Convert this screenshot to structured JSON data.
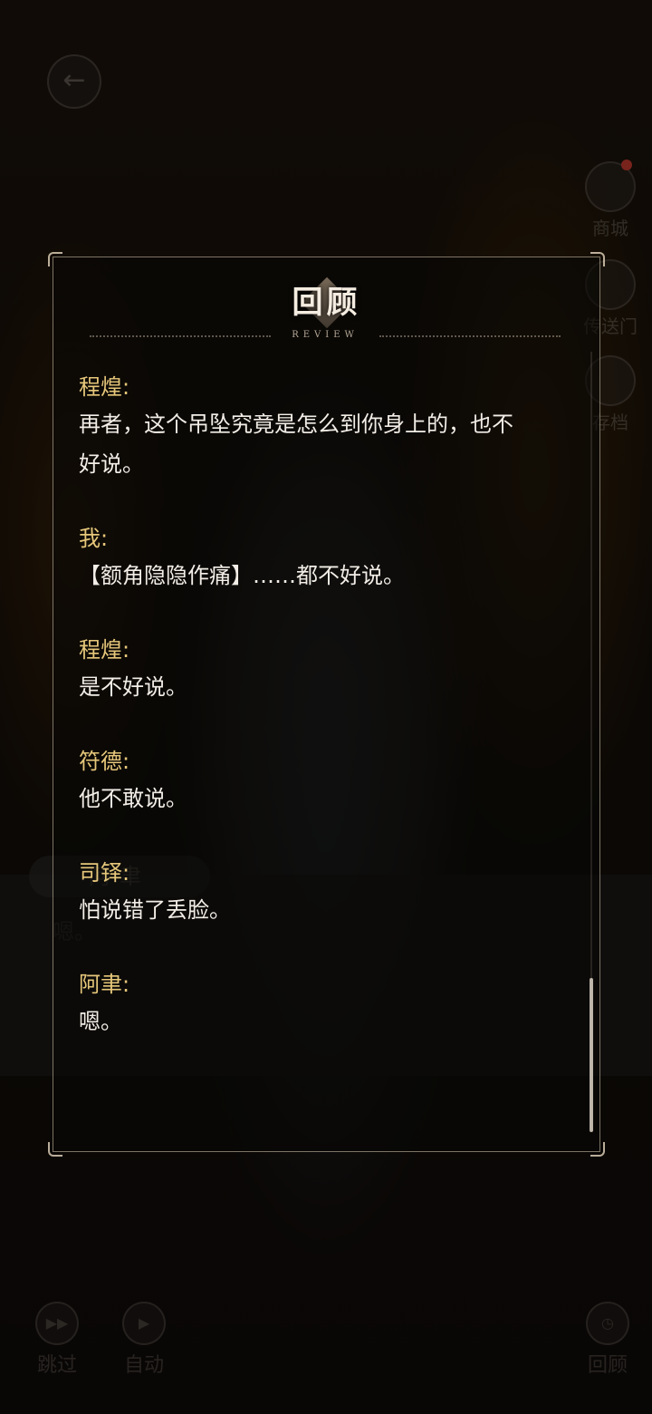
{
  "hud": {
    "back_icon": "←",
    "side": [
      {
        "label": "商城",
        "icon": "shop-icon"
      },
      {
        "label": "传送门",
        "icon": "portal-icon"
      },
      {
        "label": "存档",
        "icon": "save-icon"
      }
    ],
    "bottom": [
      {
        "label": "跳过",
        "icon": "skip-icon"
      },
      {
        "label": "自动",
        "icon": "auto-play-icon"
      },
      {
        "label": "回顾",
        "icon": "review-icon"
      }
    ],
    "speaker_tag": "阿聿",
    "current_line": "嗯。"
  },
  "review": {
    "title": "回顾",
    "subtitle": "REVIEW",
    "entries": [
      {
        "speaker": "程煌:",
        "text": [
          "再者，这个吊坠究竟是怎么到你身上的，也不",
          "好说。"
        ]
      },
      {
        "speaker": "我:",
        "text": [
          "【额角隐隐作痛】……都不好说。"
        ]
      },
      {
        "speaker": "程煌:",
        "text": [
          "是不好说。"
        ]
      },
      {
        "speaker": "符德:",
        "text": [
          "他不敢说。"
        ]
      },
      {
        "speaker": "司铎:",
        "text": [
          "怕说错了丢脸。"
        ]
      },
      {
        "speaker": "阿聿:",
        "text": [
          "嗯。"
        ]
      }
    ]
  }
}
